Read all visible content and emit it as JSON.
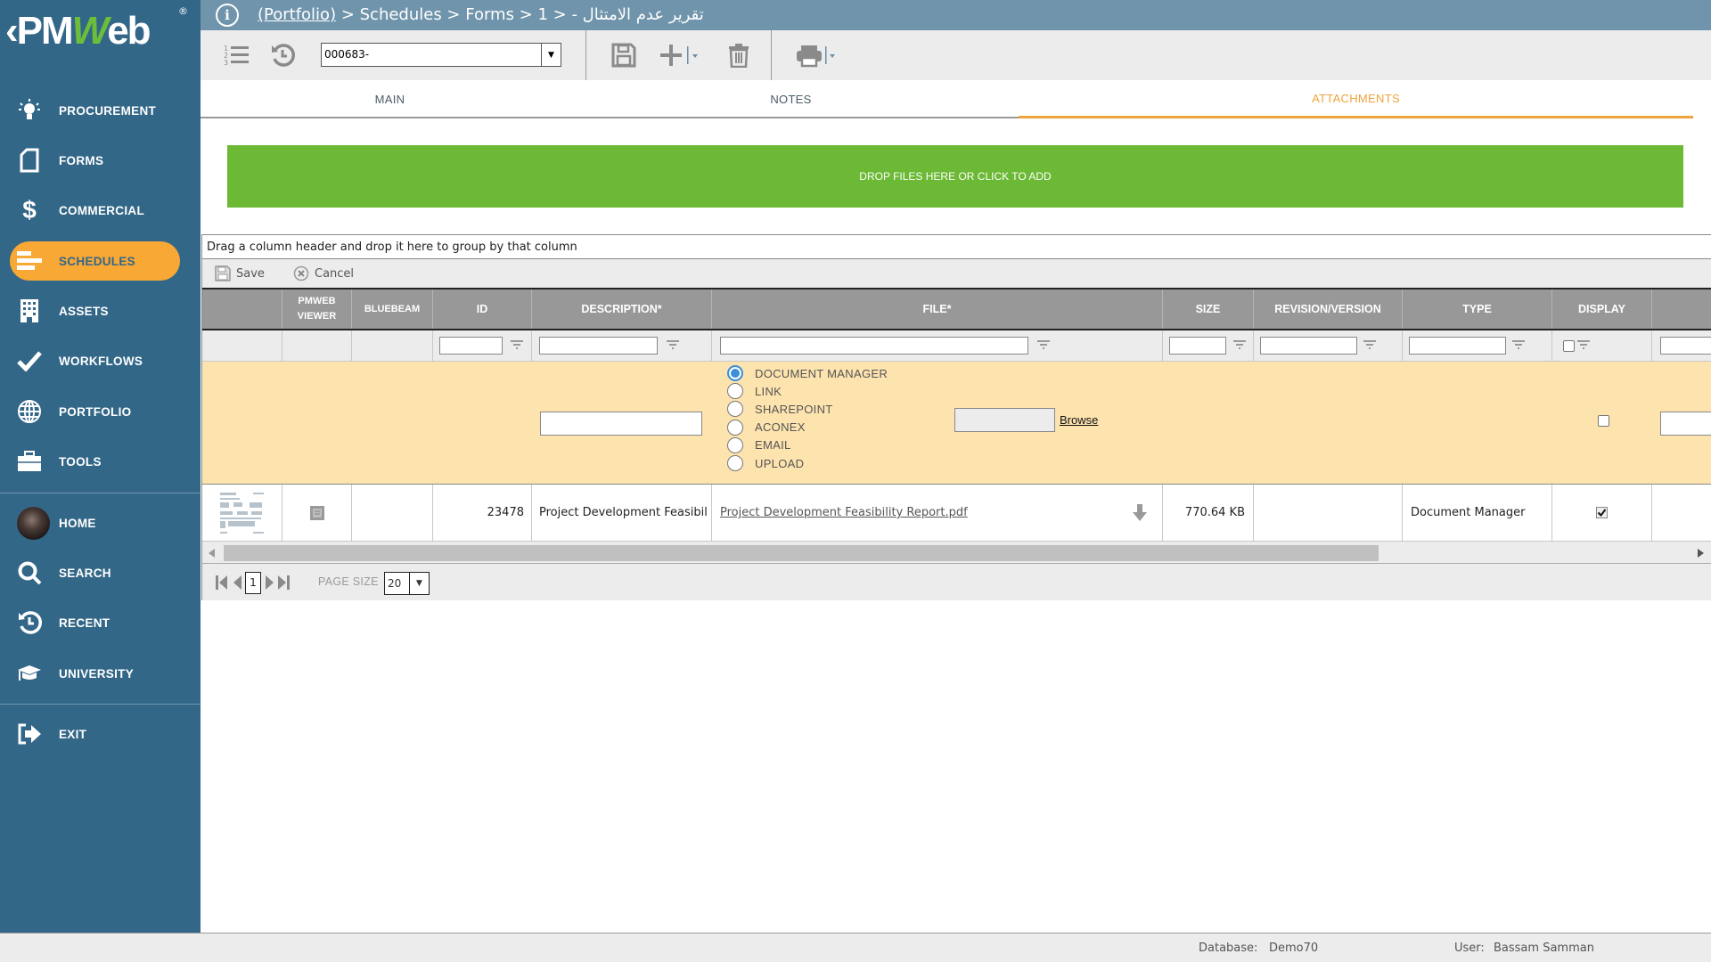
{
  "app": {
    "logo_prefix": "PM",
    "logo_w": "W",
    "logo_suffix": "eb",
    "logo_reg": "®",
    "back_glyph": "‹"
  },
  "sidebar": {
    "items": [
      {
        "label": "PROCUREMENT",
        "icon": "lightbulb-icon",
        "active": false
      },
      {
        "label": "FORMS",
        "icon": "document-icon",
        "active": false
      },
      {
        "label": "COMMERCIAL",
        "icon": "dollar-icon",
        "active": false
      },
      {
        "label": "SCHEDULES",
        "icon": "schedule-bars-icon",
        "active": true
      },
      {
        "label": "ASSETS",
        "icon": "building-icon",
        "active": false
      },
      {
        "label": "WORKFLOWS",
        "icon": "checkmark-icon",
        "active": false
      },
      {
        "label": "PORTFOLIO",
        "icon": "globe-icon",
        "active": false
      },
      {
        "label": "TOOLS",
        "icon": "toolbox-icon",
        "active": false
      }
    ],
    "bottom_items": [
      {
        "label": "HOME",
        "icon": "user-avatar"
      },
      {
        "label": "SEARCH",
        "icon": "search-icon"
      },
      {
        "label": "RECENT",
        "icon": "history-icon"
      },
      {
        "label": "UNIVERSITY",
        "icon": "graduation-cap-icon"
      }
    ],
    "exit_label": "EXIT"
  },
  "header": {
    "info_glyph": "i",
    "breadcrumb_link": "(Portfolio)",
    "breadcrumb_rest": " > Schedules > Forms > 1 > ",
    "record_title": "تقرير عدم الامتثال -"
  },
  "toolbar": {
    "record_value": "000683-",
    "icons": [
      "numbered-list-icon",
      "history-icon",
      "save-icon",
      "add-icon",
      "delete-icon",
      "print-icon"
    ]
  },
  "tabs": [
    {
      "label": "MAIN",
      "active": false
    },
    {
      "label": "NOTES",
      "active": false
    },
    {
      "label": "ATTACHMENTS",
      "active": true
    }
  ],
  "dropzone": {
    "label": "DROP FILES HERE OR CLICK TO ADD"
  },
  "grid": {
    "group_hint": "Drag a column header and drop it here to group by that column",
    "save_label": "Save",
    "cancel_label": "Cancel",
    "columns": [
      "",
      "PMWEB VIEWER",
      "BLUEBEAM",
      "ID",
      "DESCRIPTION*",
      "FILE*",
      "SIZE",
      "REVISION/VERSION",
      "TYPE",
      "DISPLAY",
      ""
    ],
    "insert_row": {
      "file_source_options": [
        "DOCUMENT MANAGER",
        "LINK",
        "SHAREPOINT",
        "ACONEX",
        "EMAIL",
        "UPLOAD"
      ],
      "selected_source": "DOCUMENT MANAGER",
      "browse_label": "Browse",
      "description_value": "",
      "display_checked": false
    },
    "rows": [
      {
        "id": "23478",
        "description": "Project Development Feasibil",
        "file": "Project Development Feasibility Report.pdf",
        "size": "770.64 KB",
        "revision": "",
        "type": "Document Manager",
        "display": true
      }
    ],
    "pager": {
      "current_page": "1",
      "page_size_label": "PAGE SIZE",
      "page_size": "20"
    }
  },
  "status": {
    "database_label": "Database:",
    "database_value": "Demo70",
    "user_label": "User:",
    "user_value": "Bassam Samman"
  }
}
